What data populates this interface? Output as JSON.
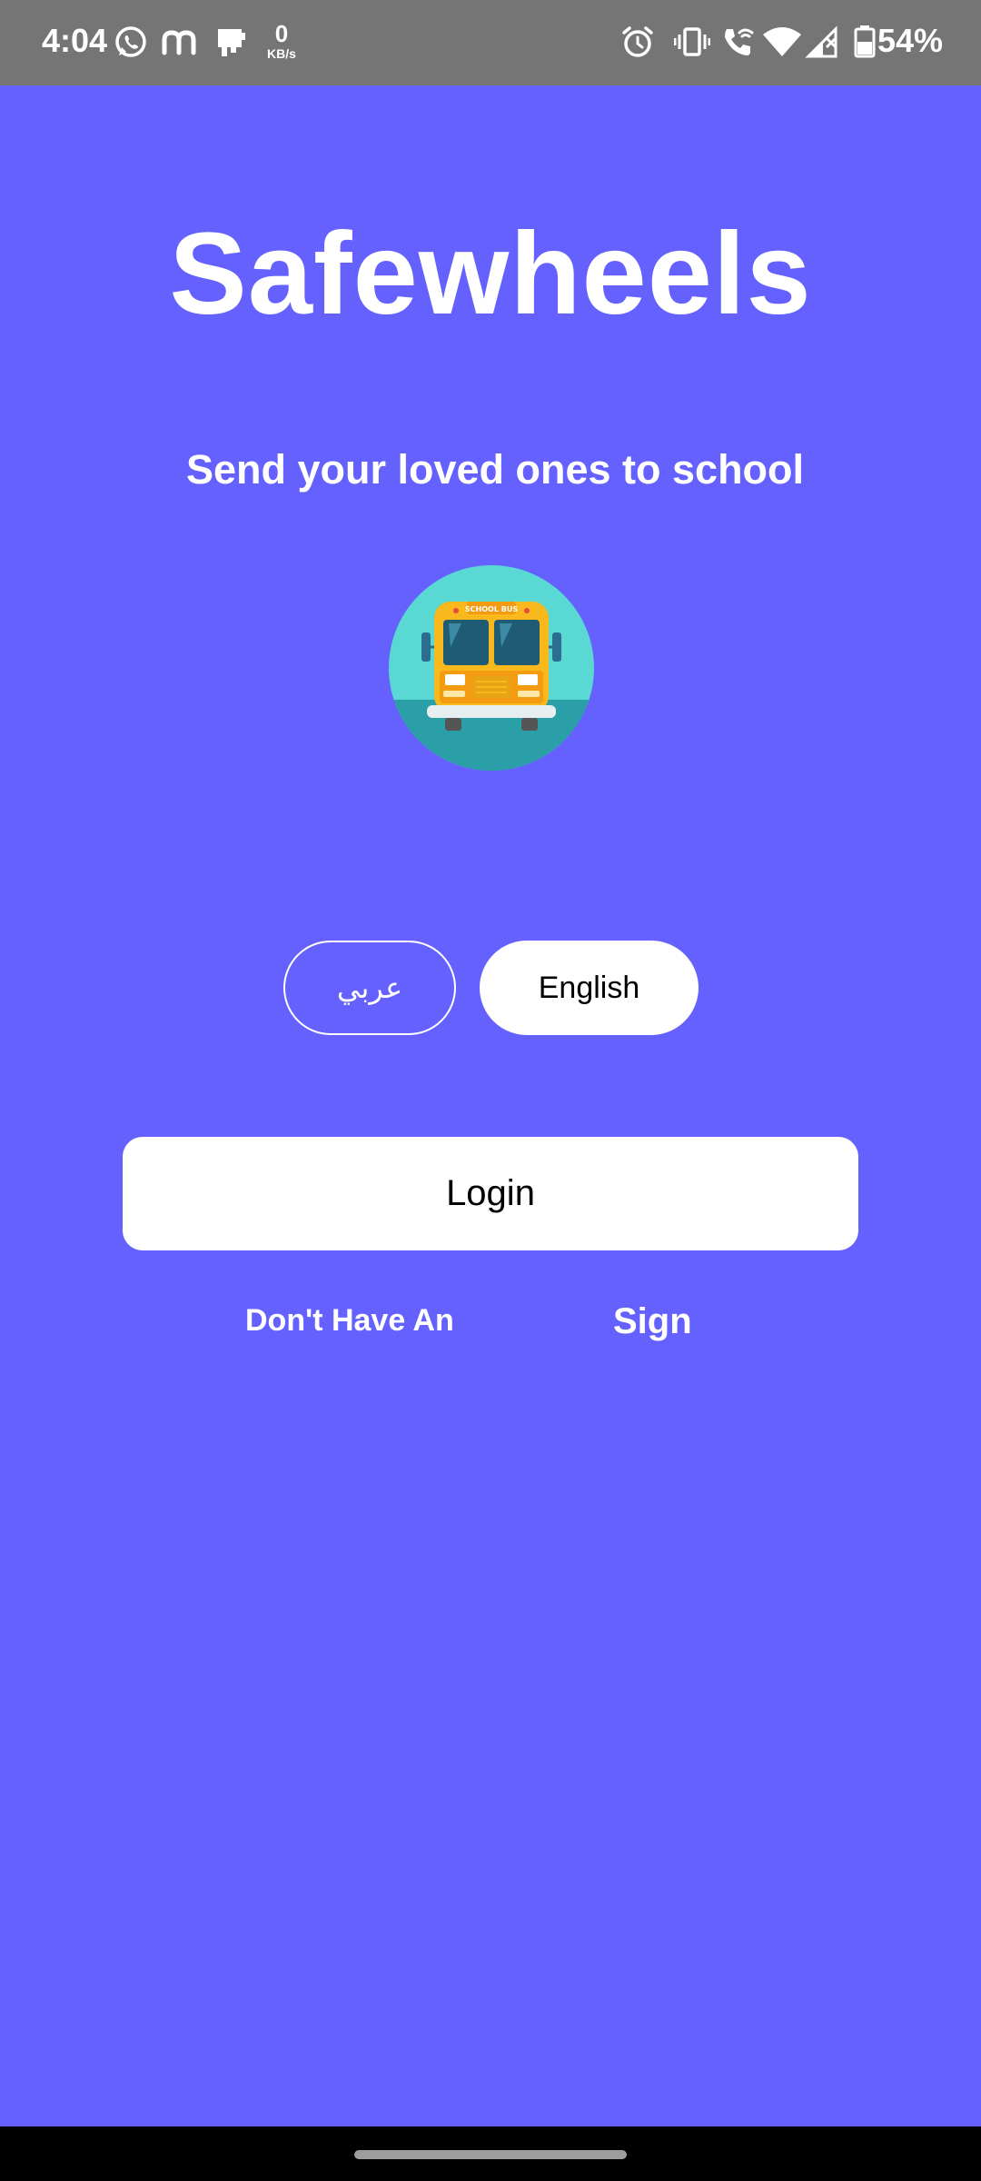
{
  "status_bar": {
    "time": "4:04",
    "net_speed_value": "0",
    "net_speed_unit": "KB/s",
    "battery_percent": "54%",
    "icons": [
      "whatsapp-icon",
      "m-app-icon",
      "sim-card-icon",
      "alarm-icon",
      "vibrate-icon",
      "wifi-calling-icon",
      "wifi-icon",
      "signal-icon",
      "battery-icon"
    ]
  },
  "app": {
    "title": "Safewheels",
    "tagline": "Send your loved ones to school",
    "logo_icon": "school-bus-icon"
  },
  "language": {
    "arabic_label": "عربي",
    "english_label": "English",
    "selected": "English"
  },
  "auth": {
    "login_label": "Login",
    "no_account_text": "Don't Have An",
    "sign_label": "Sign"
  },
  "colors": {
    "background": "#6461FE",
    "status_bar": "#757575",
    "button_bg": "#FFFFFF",
    "text_light": "#FFFFFF",
    "text_dark": "#000000"
  }
}
